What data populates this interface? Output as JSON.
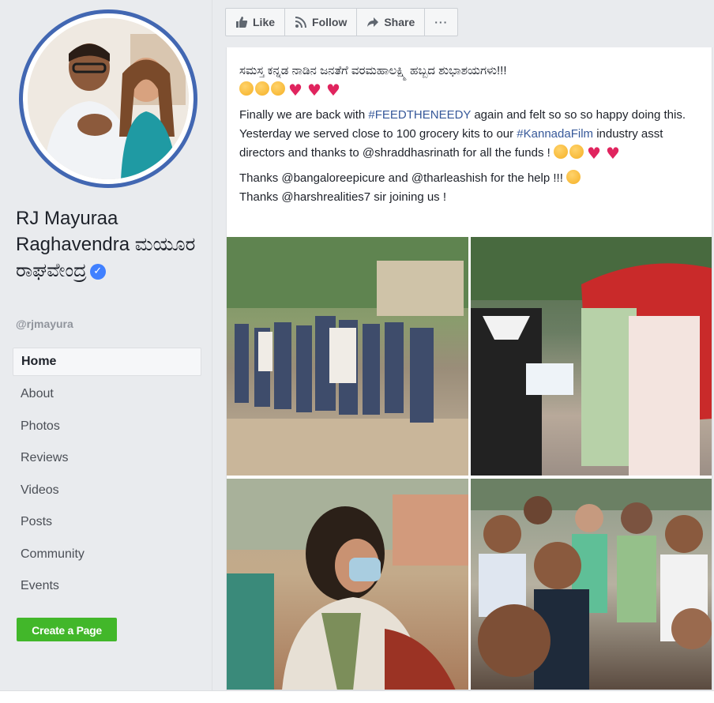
{
  "sidebar": {
    "page_name": "RJ Mayuraa Raghavendra ಮಯೂರ ರಾಘವೇಂದ್ರ",
    "handle": "@rjmayura",
    "verified_icon": "verified-check-icon",
    "nav": [
      {
        "label": "Home",
        "active": true
      },
      {
        "label": "About"
      },
      {
        "label": "Photos"
      },
      {
        "label": "Reviews"
      },
      {
        "label": "Videos"
      },
      {
        "label": "Posts"
      },
      {
        "label": "Community"
      },
      {
        "label": "Events"
      }
    ],
    "create_page_label": "Create a Page"
  },
  "actions": {
    "like": "Like",
    "follow": "Follow",
    "share": "Share",
    "more": "···"
  },
  "post": {
    "line1": "ಸಮಸ್ತ ಕನ್ನಡ ನಾಡಿನ ಜನತೆಗೆ ವರಮಹಾಲಕ್ಷ್ಮಿ ಹಬ್ಬದ ಶುಭಾಶಯಗಳು!!!",
    "p2_pre": "Finally we are back with ",
    "p2_hashtag1": "#FEEDTHENEEDY",
    "p2_mid": " again and felt so so so happy doing this. Yesterday we served close to 100 grocery kits to our ",
    "p2_hashtag2": "#KannadaFilm",
    "p2_post": " industry asst directors and thanks to @shraddhasrinath for all the funds !",
    "p3_line1": "Thanks @bangaloreepicure and @tharleashish for the help !!!",
    "p3_line2": "Thanks @harshrealities7 sir joining us !"
  },
  "colors": {
    "fb_blue": "#4267b2",
    "hashtag": "#365899",
    "create_green": "#42b72a",
    "heart": "#e0245e"
  }
}
